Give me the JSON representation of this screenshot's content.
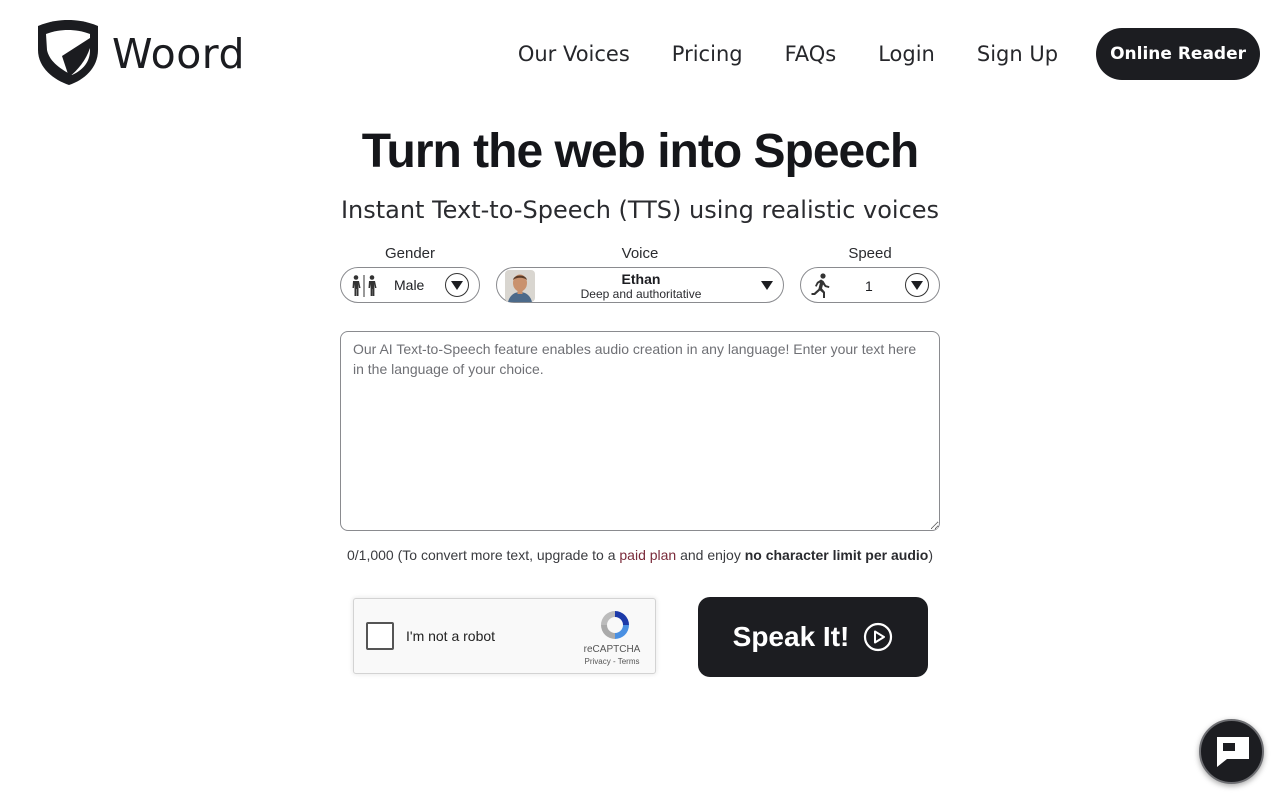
{
  "brand": {
    "name": "Woord",
    "logo_icon": "shield-logo-icon"
  },
  "nav": {
    "links": [
      "Our Voices",
      "Pricing",
      "FAQs",
      "Login",
      "Sign Up"
    ],
    "cta": "Online Reader"
  },
  "hero": {
    "title": "Turn the web into Speech",
    "subtitle": "Instant Text-to-Speech (TTS) using realistic voices"
  },
  "selectors": {
    "gender": {
      "label": "Gender",
      "value": "Male",
      "icon": "male-female-icon"
    },
    "voice": {
      "label": "Voice",
      "name": "Ethan",
      "description": "Deep and authoritative",
      "icon": "voice-avatar"
    },
    "speed": {
      "label": "Speed",
      "value": "1",
      "icon": "running-person-icon"
    }
  },
  "editor": {
    "placeholder": "Our AI Text-to-Speech feature enables audio creation in any language! Enter your text here in the language of your choice.",
    "value": ""
  },
  "counter": {
    "count": "0/1,000",
    "text_before": "(To convert more text, upgrade to a ",
    "link": "paid plan",
    "text_middle": " and enjoy ",
    "bold": "no character limit per audio",
    "text_after": ")"
  },
  "captcha": {
    "label": "I'm not a robot",
    "brand": "reCAPTCHA",
    "links": "Privacy - Terms"
  },
  "speak_button": {
    "label": "Speak It!",
    "icon": "play-circle-icon"
  },
  "chat": {
    "icon": "chat-bubble-icon"
  },
  "colors": {
    "primary": "#1c1d21",
    "link": "#7a2a3a",
    "background": "#ffffff"
  }
}
